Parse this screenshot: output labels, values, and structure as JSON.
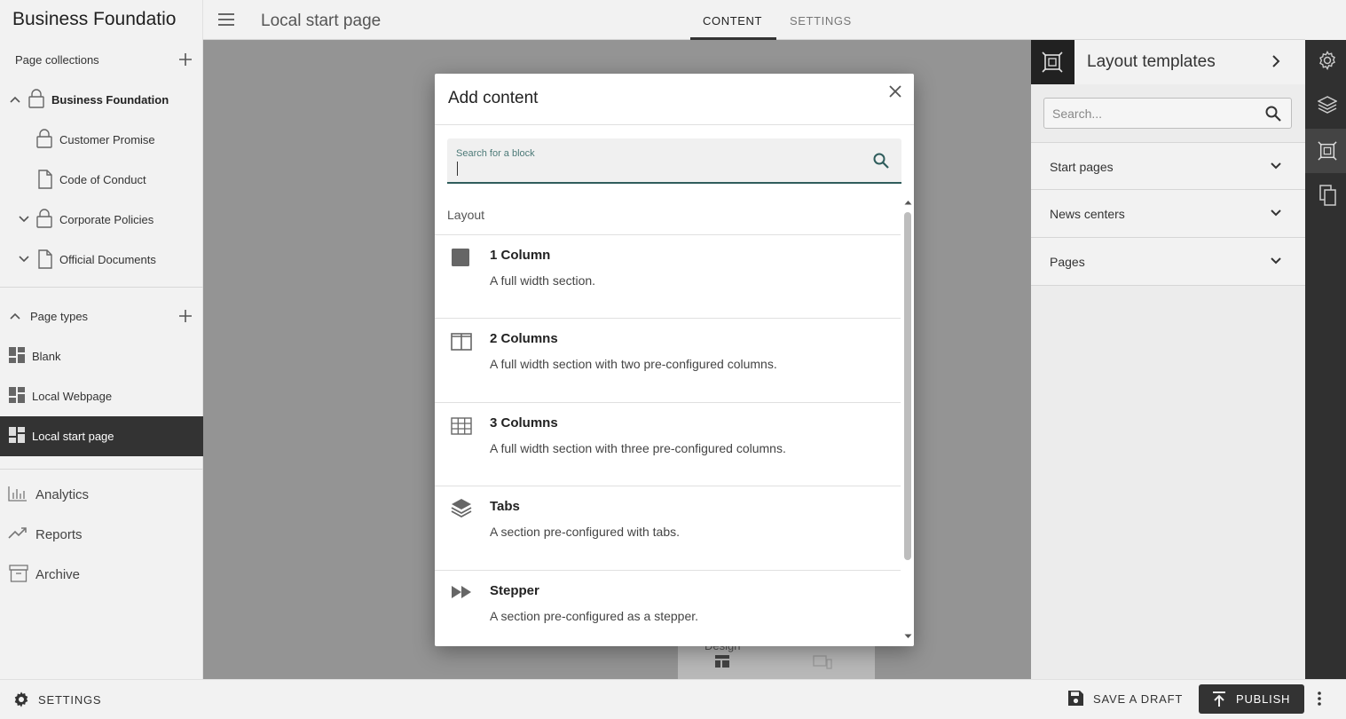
{
  "sidebar": {
    "app_title": "Business Foundatio",
    "collections_header": "Page collections",
    "collections": [
      {
        "label": "Business Foundation",
        "icon": "lock-icon"
      },
      {
        "label": "Customer Promise",
        "icon": "lock-icon"
      },
      {
        "label": "Code of Conduct",
        "icon": "document-icon"
      },
      {
        "label": "Corporate Policies",
        "icon": "lock-icon"
      },
      {
        "label": "Official Documents",
        "icon": "document-icon"
      }
    ],
    "page_types_header": "Page types",
    "page_types": [
      {
        "label": "Blank",
        "icon": "dashboard-icon"
      },
      {
        "label": "Local Webpage",
        "icon": "dashboard-icon"
      },
      {
        "label": "Local start page",
        "icon": "dashboard-icon",
        "selected": true
      }
    ],
    "nav": [
      {
        "label": "Analytics",
        "icon": "bar-chart-icon"
      },
      {
        "label": "Reports",
        "icon": "trending-up-icon"
      },
      {
        "label": "Archive",
        "icon": "archive-icon"
      }
    ]
  },
  "topbar": {
    "page_title": "Local start page",
    "tabs": [
      "CONTENT",
      "SETTINGS"
    ],
    "active_tab": "CONTENT"
  },
  "right_panel": {
    "title": "Layout templates",
    "search_placeholder": "Search...",
    "sections": [
      "Start pages",
      "News centers",
      "Pages"
    ]
  },
  "bottombar": {
    "settings_label": "SETTINGS",
    "save_draft_label": "SAVE A DRAFT",
    "publish_label": "PUBLISH"
  },
  "canvas": {
    "card_label": "Design"
  },
  "dialog": {
    "title": "Add content",
    "search_label": "Search for a block",
    "section_label": "Layout",
    "blocks": [
      {
        "title": "1 Column",
        "description": "A full width section.",
        "icon": "square-icon"
      },
      {
        "title": "2 Columns",
        "description": "A full width section with two pre-configured columns.",
        "icon": "two-columns-icon"
      },
      {
        "title": "3 Columns",
        "description": "A full width section with three pre-configured columns.",
        "icon": "grid-icon"
      },
      {
        "title": "Tabs",
        "description": "A section pre-configured with tabs.",
        "icon": "layers-icon"
      },
      {
        "title": "Stepper",
        "description": "A section pre-configured as a stepper.",
        "icon": "fast-forward-icon"
      }
    ]
  },
  "colors": {
    "dark": "#333333",
    "accent_teal": "#2f5d5c",
    "canvas_gray": "#949494"
  }
}
